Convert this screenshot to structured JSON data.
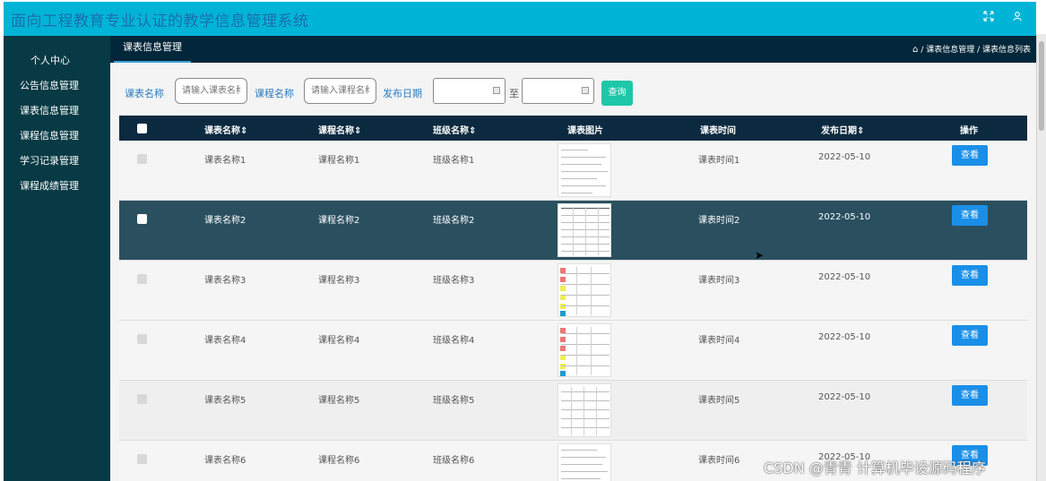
{
  "app": {
    "title": "面向工程教育专业认证的教学信息管理系统"
  },
  "topbar": {
    "fullscreen_icon": "expand-icon",
    "user_icon": "user-icon"
  },
  "sidebar": {
    "items": [
      {
        "label": "个人中心"
      },
      {
        "label": "公告信息管理"
      },
      {
        "label": "课表信息管理"
      },
      {
        "label": "课程信息管理"
      },
      {
        "label": "学习记录管理"
      },
      {
        "label": "课程成绩管理"
      }
    ]
  },
  "tabs": [
    {
      "label": "课表信息管理"
    }
  ],
  "breadcrumb": {
    "home_icon": "home-icon",
    "text": "/ 课表信息管理 / 课表信息列表"
  },
  "filters": {
    "schedule_label": "课表名称",
    "schedule_placeholder": "请输入课表名称",
    "course_label": "课程名称",
    "course_placeholder": "请输入课程名称",
    "date_label": "发布日期",
    "to_label": "至",
    "search_button": "查询"
  },
  "table": {
    "headers": [
      "课表名称",
      "课程名称",
      "班级名称",
      "课表图片",
      "课表时间",
      "发布日期",
      "操作"
    ],
    "sort_glyph": "⇕",
    "rows": [
      {
        "schedule": "课表名称1",
        "course": "课程名称1",
        "class": "班级名称1",
        "time": "课表时间1",
        "date": "2022-05-10",
        "action": "查看"
      },
      {
        "schedule": "课表名称2",
        "course": "课程名称2",
        "class": "班级名称2",
        "time": "课表时间2",
        "date": "2022-05-10",
        "action": "查看"
      },
      {
        "schedule": "课表名称3",
        "course": "课程名称3",
        "class": "班级名称3",
        "time": "课表时间3",
        "date": "2022-05-10",
        "action": "查看"
      },
      {
        "schedule": "课表名称4",
        "course": "课程名称4",
        "class": "班级名称4",
        "time": "课表时间4",
        "date": "2022-05-10",
        "action": "查看"
      },
      {
        "schedule": "课表名称5",
        "course": "课程名称5",
        "class": "班级名称5",
        "time": "课表时间5",
        "date": "2022-05-10",
        "action": "查看"
      },
      {
        "schedule": "课表名称6",
        "course": "课程名称6",
        "class": "班级名称6",
        "time": "课表时间6",
        "date": "2022-05-10",
        "action": "查看"
      }
    ]
  },
  "watermark": "CSDN @青青  计算机毕设源码程序",
  "colors": {
    "topbar": "#00b4d8",
    "sidebar": "#073a44",
    "header": "#0b2a40",
    "highlight_row": "#2a5060",
    "search_button": "#1ec7a7",
    "view_button": "#1a8fe8"
  }
}
